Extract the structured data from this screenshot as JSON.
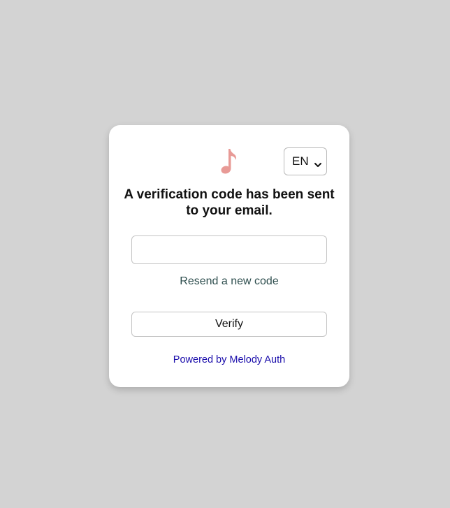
{
  "colors": {
    "background": "#d3d3d3",
    "card": "#ffffff",
    "logo": "#e89a96",
    "resend_text": "#2f4f4f",
    "link": "#1a0dab"
  },
  "logo": {
    "icon": "music-note-icon"
  },
  "language": {
    "selected": "EN",
    "icon": "chevron-down-icon"
  },
  "header": {
    "title": "A verification code has been sent to your email."
  },
  "code_input": {
    "value": "",
    "placeholder": ""
  },
  "resend": {
    "label": "Resend a new code"
  },
  "verify": {
    "label": "Verify"
  },
  "footer": {
    "powered_by": "Powered by Melody Auth"
  }
}
